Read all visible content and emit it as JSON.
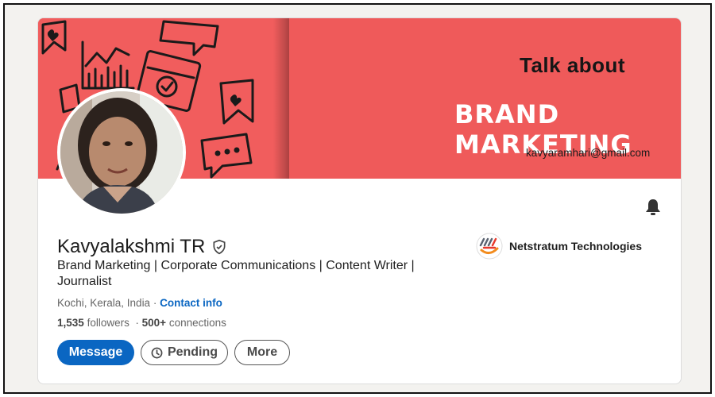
{
  "banner": {
    "talk_text": "Talk about",
    "brand_text": "BRAND MARKETING",
    "email": "kavyaramhari@gmail.com",
    "colors": {
      "banner_bg": "#ef5a5a",
      "brand_text": "#ffffff"
    }
  },
  "profile": {
    "name": "Kavyalakshmi TR",
    "headline": "Brand Marketing | Corporate Communications | Content Writer | Journalist",
    "location": "Kochi, Kerala, India",
    "separator": " · ",
    "contact_label": "Contact info",
    "followers_count": "1,535",
    "followers_label": "followers",
    "connections_count": "500+",
    "connections_label": "connections",
    "bullet": "·"
  },
  "company": {
    "name": "Netstratum Technologies"
  },
  "actions": {
    "message_label": "Message",
    "pending_label": "Pending",
    "more_label": "More"
  },
  "icons": {
    "bell": "bell-icon",
    "verified": "verified-shield-icon",
    "clock": "clock-icon",
    "company_logo": "netstratum-logo"
  },
  "colors": {
    "accent": "#0a66c2"
  }
}
